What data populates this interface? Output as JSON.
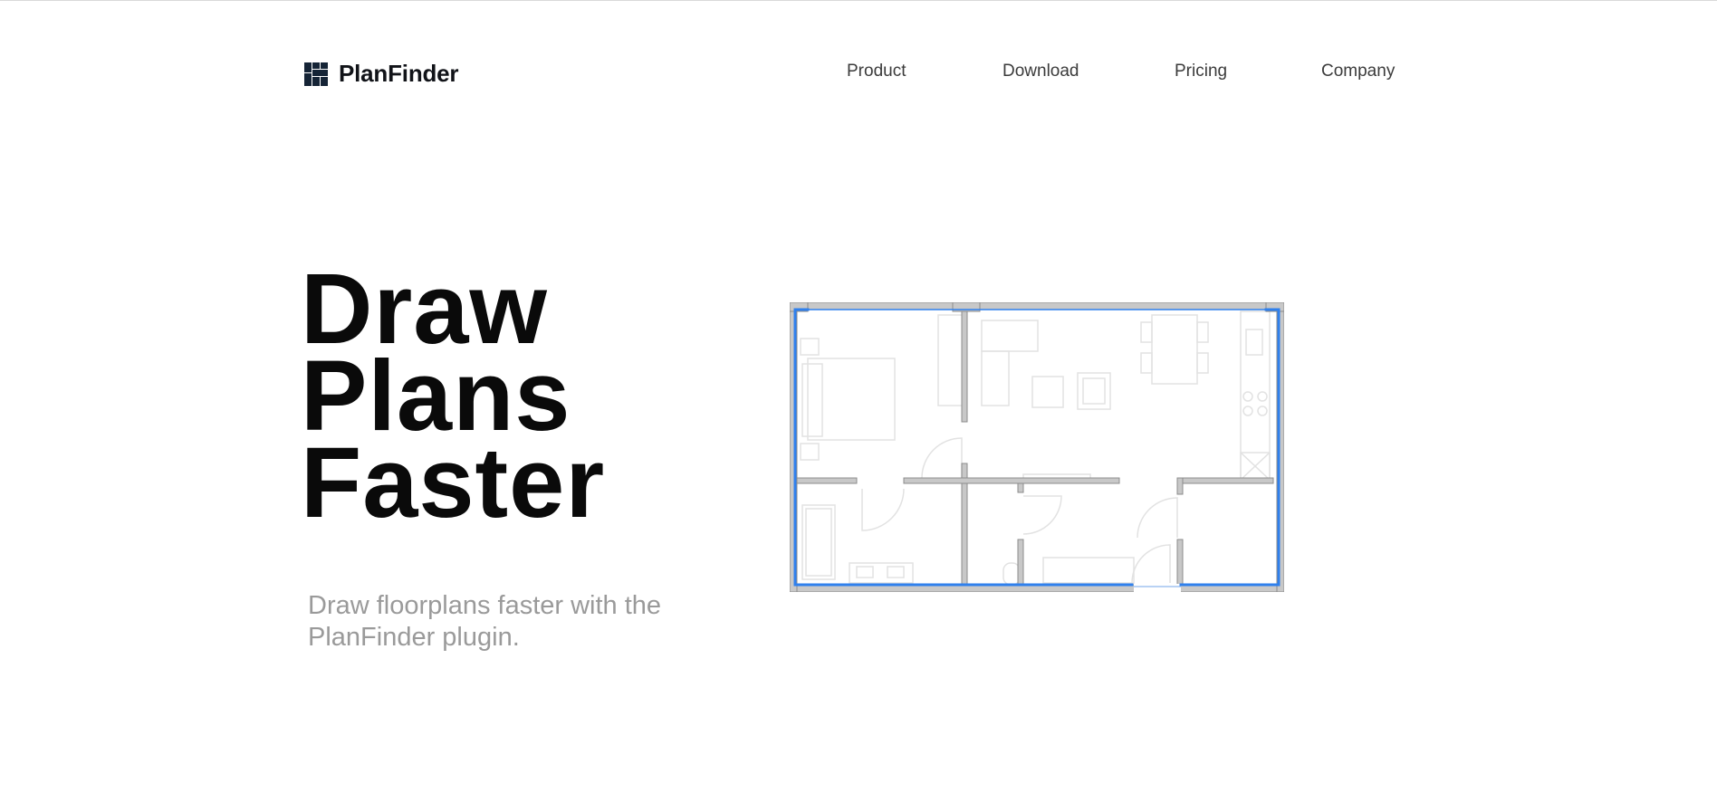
{
  "brand": {
    "name": "PlanFinder",
    "logo_icon": "grid-blocks-icon",
    "logo_color": "#152436"
  },
  "nav": {
    "items": [
      {
        "label": "Product"
      },
      {
        "label": "Download"
      },
      {
        "label": "Pricing"
      },
      {
        "label": "Company"
      }
    ]
  },
  "hero": {
    "title_lines": [
      "Draw",
      "Plans",
      "Faster"
    ],
    "subtitle": "Draw floorplans faster with the PlanFinder plugin."
  },
  "illustration": {
    "name": "floor-plan-drawing",
    "wall_color": "#c8c8c8",
    "wall_outline_color": "#8c8c8c",
    "highlight_color": "#2f80ed",
    "furniture_color": "#e2e2e2"
  }
}
